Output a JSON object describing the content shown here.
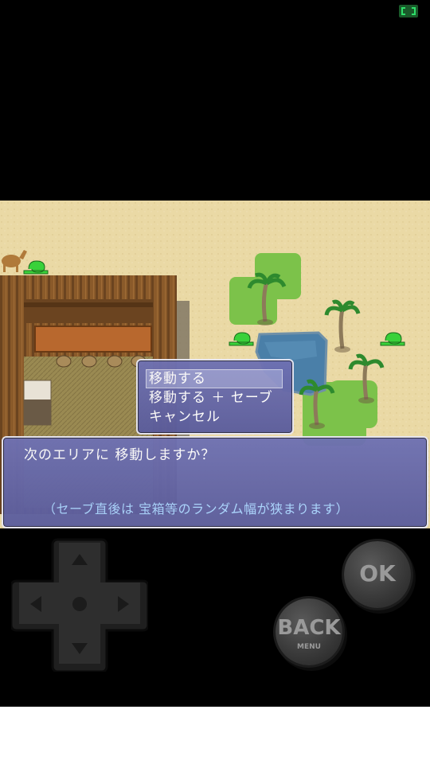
{
  "topbar": {
    "fullscreen_icon": "fullscreen-icon"
  },
  "choices": {
    "items": [
      {
        "label": "移動する",
        "selected": true
      },
      {
        "label": "移動する ＋ セーブ",
        "selected": false
      },
      {
        "label": "キャンセル",
        "selected": false
      }
    ]
  },
  "message": {
    "line1": "次のエリアに 移動しますか？",
    "line2": "（セーブ直後は 宝箱等のランダム幅が狭まります）"
  },
  "controls": {
    "dpad_icon": "dpad-icon",
    "ok_label": "OK",
    "back_label": "BACK",
    "back_sublabel": "MENU"
  },
  "colors": {
    "sand": "#ead9a5",
    "grass": "#7cc24a",
    "water": "#4a7fa8",
    "window": "#6668a8",
    "hint_text": "#a9d4ff"
  }
}
